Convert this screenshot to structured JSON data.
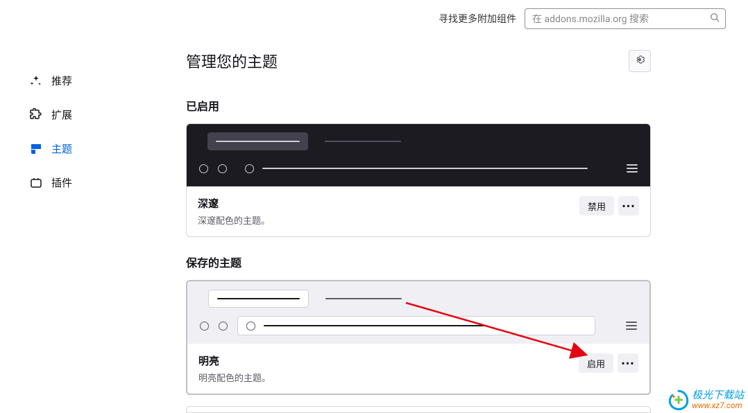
{
  "topbar": {
    "find_more_label": "寻找更多附加组件",
    "search_placeholder": "在 addons.mozilla.org 搜索"
  },
  "sidebar": {
    "items": [
      {
        "label": "推荐"
      },
      {
        "label": "扩展"
      },
      {
        "label": "主题"
      },
      {
        "label": "插件"
      }
    ]
  },
  "page": {
    "title": "管理您的主题"
  },
  "sections": {
    "enabled_heading": "已启用",
    "saved_heading": "保存的主题"
  },
  "themes": {
    "enabled": {
      "name": "深邃",
      "desc": "深邃配色的主题。",
      "action_label": "禁用"
    },
    "saved": {
      "name": "明亮",
      "desc": "明亮配色的主题。",
      "action_label": "启用"
    }
  },
  "watermark": {
    "cn": "极光下载站",
    "url": "www.xz7.com"
  }
}
